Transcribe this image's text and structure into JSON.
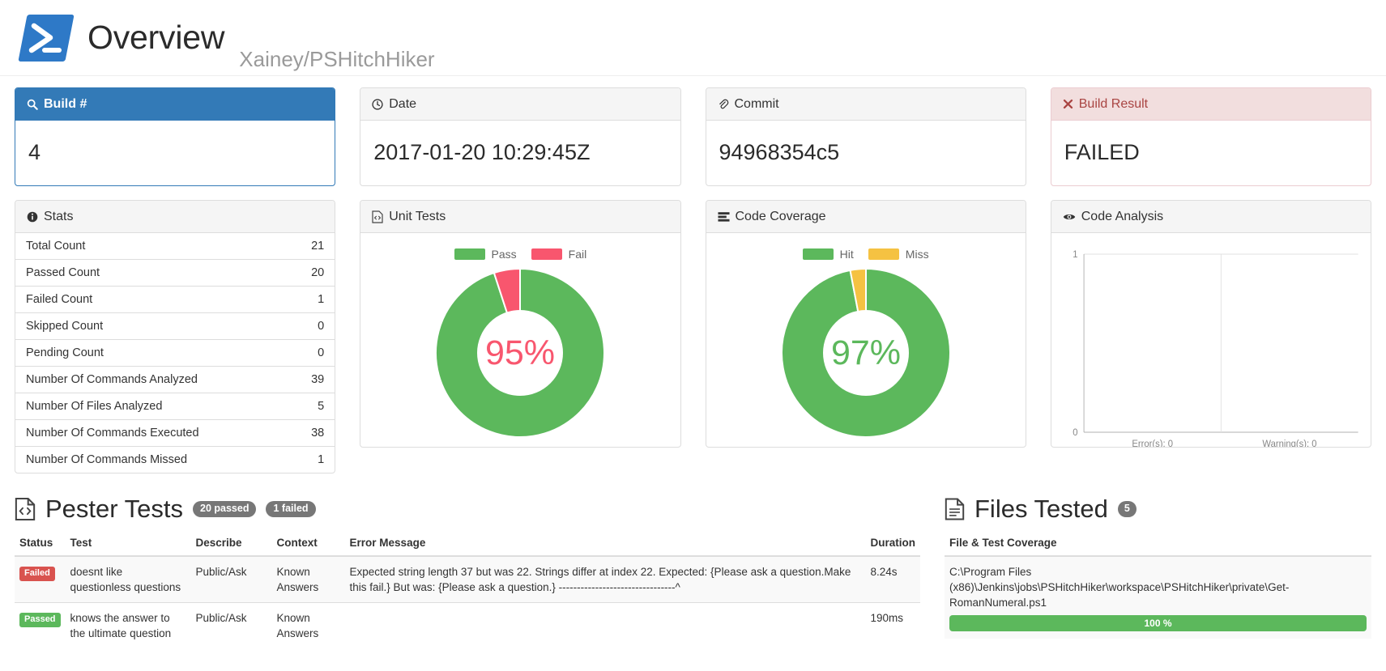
{
  "header": {
    "logo_icon": "powershell-logo",
    "title": "Overview",
    "repo": "Xainey/PSHitchHiker"
  },
  "cards": {
    "build": {
      "icon": "search-icon",
      "title": "Build #",
      "value": "4"
    },
    "date": {
      "icon": "clock-icon",
      "title": "Date",
      "value": "2017-01-20 10:29:45Z"
    },
    "commit": {
      "icon": "paperclip-icon",
      "title": "Commit",
      "value": "94968354c5"
    },
    "build_result": {
      "icon": "times-icon",
      "title": "Build Result",
      "value": "FAILED"
    }
  },
  "stats": {
    "icon": "info-circle-icon",
    "title": "Stats",
    "rows": [
      {
        "label": "Total Count",
        "value": "21"
      },
      {
        "label": "Passed Count",
        "value": "20"
      },
      {
        "label": "Failed Count",
        "value": "1"
      },
      {
        "label": "Skipped Count",
        "value": "0"
      },
      {
        "label": "Pending Count",
        "value": "0"
      },
      {
        "label": "Number Of Commands Analyzed",
        "value": "39"
      },
      {
        "label": "Number Of Files Analyzed",
        "value": "5"
      },
      {
        "label": "Number Of Commands Executed",
        "value": "38"
      },
      {
        "label": "Number Of Commands Missed",
        "value": "1"
      }
    ]
  },
  "unit_tests": {
    "icon": "file-code-icon",
    "title": "Unit Tests",
    "center_label": "95%",
    "center_color": "#f8566e"
  },
  "code_coverage": {
    "icon": "server-icon",
    "title": "Code Coverage",
    "center_label": "97%",
    "center_color": "#5cb85c"
  },
  "code_analysis": {
    "icon": "eye-icon",
    "title": "Code Analysis"
  },
  "pester": {
    "icon": "file-code-icon",
    "title": "Pester Tests",
    "badge_passed": "20 passed",
    "badge_failed": "1 failed",
    "columns": [
      "Status",
      "Test",
      "Describe",
      "Context",
      "Error Message",
      "Duration"
    ],
    "rows": [
      {
        "status": "Failed",
        "status_kind": "failed",
        "test": "doesnt like questionless questions",
        "describe": "Public/Ask",
        "context": "Known Answers",
        "error": "Expected string length 37 but was 22. Strings differ at index 22. Expected: {Please ask a question.Make this fail.} But was: {Please ask a question.} --------------------------------^",
        "duration": "8.24s"
      },
      {
        "status": "Passed",
        "status_kind": "passed",
        "test": "knows the answer to the ultimate question",
        "describe": "Public/Ask",
        "context": "Known Answers",
        "error": "",
        "duration": "190ms"
      }
    ]
  },
  "files_tested": {
    "icon": "file-text-icon",
    "title": "Files Tested",
    "badge": "5",
    "column_header": "File & Test Coverage",
    "files": [
      {
        "path": "C:\\Program Files (x86)\\Jenkins\\jobs\\PSHitchHiker\\workspace\\PSHitchHiker\\private\\Get-RomanNumeral.ps1",
        "coverage_label": "100 %",
        "coverage_pct": 100
      }
    ]
  },
  "colors": {
    "primary": "#337ab7",
    "success": "#5cb85c",
    "danger": "#d9534f",
    "pink": "#f8566e",
    "warning": "#f5c242",
    "muted": "#777777"
  },
  "chart_data": [
    {
      "type": "pie",
      "title": "Unit Tests",
      "labels": [
        "Pass",
        "Fail"
      ],
      "values": [
        95,
        5
      ],
      "colors": [
        "#5cb85c",
        "#f8566e"
      ],
      "center_text": "95%",
      "legend_position": "top",
      "donut": true
    },
    {
      "type": "pie",
      "title": "Code Coverage",
      "labels": [
        "Hit",
        "Miss"
      ],
      "values": [
        97,
        3
      ],
      "colors": [
        "#5cb85c",
        "#f5c242"
      ],
      "center_text": "97%",
      "legend_position": "top",
      "donut": true
    },
    {
      "type": "bar",
      "title": "Code Analysis",
      "categories": [
        "Error(s): 0",
        "Warning(s): 0"
      ],
      "values": [
        0,
        0
      ],
      "xlabel": "",
      "ylabel": "",
      "ylim": [
        0,
        1
      ],
      "yticks": [
        "0",
        "1"
      ],
      "grid": true
    }
  ]
}
